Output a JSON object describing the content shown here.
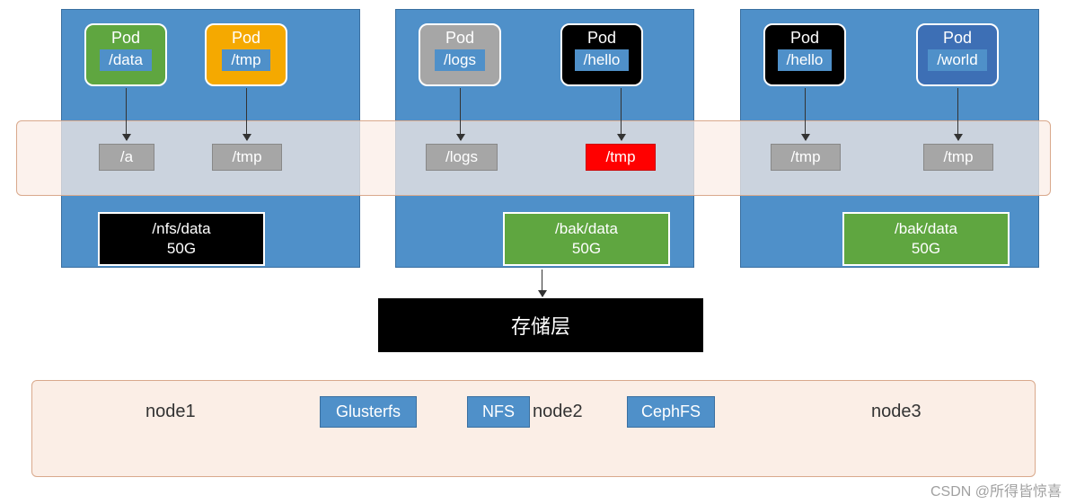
{
  "nodes": [
    {
      "pods": [
        {
          "label": "Pod",
          "path": "/data",
          "color": "#5fa640"
        },
        {
          "label": "Pod",
          "path": "/tmp",
          "color": "#f5a900"
        }
      ],
      "mounts": [
        {
          "path": "/a",
          "color": "gray"
        },
        {
          "path": "/tmp",
          "color": "gray"
        }
      ],
      "pv": {
        "path": "/nfs/data",
        "size": "50G",
        "color": "black"
      }
    },
    {
      "pods": [
        {
          "label": "Pod",
          "path": "/logs",
          "color": "#a6a6a6"
        },
        {
          "label": "Pod",
          "path": "/hello",
          "color": "#000000"
        }
      ],
      "mounts": [
        {
          "path": "/logs",
          "color": "gray"
        },
        {
          "path": "/tmp",
          "color": "red"
        }
      ],
      "pv": {
        "path": "/bak/data",
        "size": "50G",
        "color": "green"
      }
    },
    {
      "pods": [
        {
          "label": "Pod",
          "path": "/hello",
          "color": "#000000"
        },
        {
          "label": "Pod",
          "path": "/world",
          "color": "#3d6fb5"
        }
      ],
      "mounts": [
        {
          "path": "/tmp",
          "color": "gray"
        },
        {
          "path": "/tmp",
          "color": "gray"
        }
      ],
      "pv": {
        "path": "/bak/data",
        "size": "50G",
        "color": "green"
      }
    }
  ],
  "storage_layer_label": "存储层",
  "bottom": {
    "node_labels": [
      "node1",
      "node2",
      "node3"
    ],
    "filesystems": [
      "Glusterfs",
      "NFS",
      "CephFS"
    ]
  },
  "watermark": "CSDN @所得皆惊喜"
}
